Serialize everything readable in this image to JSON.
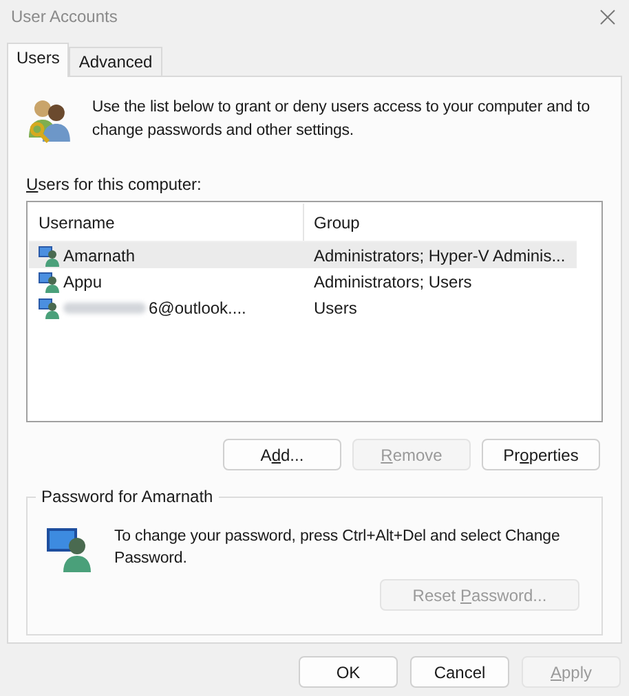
{
  "window": {
    "title": "User Accounts"
  },
  "tabs": [
    {
      "label": "Users",
      "selected": true
    },
    {
      "label": "Advanced",
      "selected": false
    }
  ],
  "intro": "Use the list below to grant or deny users access to your computer and to change passwords and other settings.",
  "users_label": [
    {
      "text": "U",
      "key": true
    },
    {
      "text": "sers for this computer:",
      "key": false
    }
  ],
  "list": {
    "columns": [
      "Username",
      "Group"
    ],
    "rows": [
      {
        "username": "Amarnath",
        "group": "Administrators; Hyper-V Adminis...",
        "selected": true,
        "redacted": false
      },
      {
        "username": "Appu",
        "group": "Administrators; Users",
        "selected": false,
        "redacted": false
      },
      {
        "username": "6@outlook....",
        "group": "Users",
        "selected": false,
        "redacted": true
      }
    ]
  },
  "list_buttons": [
    {
      "parts": [
        {
          "text": "A",
          "key": false
        },
        {
          "text": "d",
          "key": true
        },
        {
          "text": "d...",
          "key": false
        }
      ],
      "disabled": false
    },
    {
      "parts": [
        {
          "text": "R",
          "key": true
        },
        {
          "text": "emove",
          "key": false
        }
      ],
      "disabled": true
    },
    {
      "parts": [
        {
          "text": "Pr",
          "key": false
        },
        {
          "text": "o",
          "key": true
        },
        {
          "text": "perties",
          "key": false
        }
      ],
      "disabled": false
    }
  ],
  "password": {
    "legend": "Password for Amarnath",
    "text": "To change your password, press Ctrl+Alt+Del and select Change Password.",
    "reset": {
      "parts": [
        {
          "text": "Reset ",
          "key": false
        },
        {
          "text": "P",
          "key": true
        },
        {
          "text": "assword...",
          "key": false
        }
      ],
      "disabled": true
    }
  },
  "footer_buttons": [
    {
      "parts": [
        {
          "text": "OK",
          "key": false
        }
      ],
      "disabled": false
    },
    {
      "parts": [
        {
          "text": "Cancel",
          "key": false
        }
      ],
      "disabled": false
    },
    {
      "parts": [
        {
          "text": "A",
          "key": true
        },
        {
          "text": "pply",
          "key": false
        }
      ],
      "disabled": true
    }
  ]
}
